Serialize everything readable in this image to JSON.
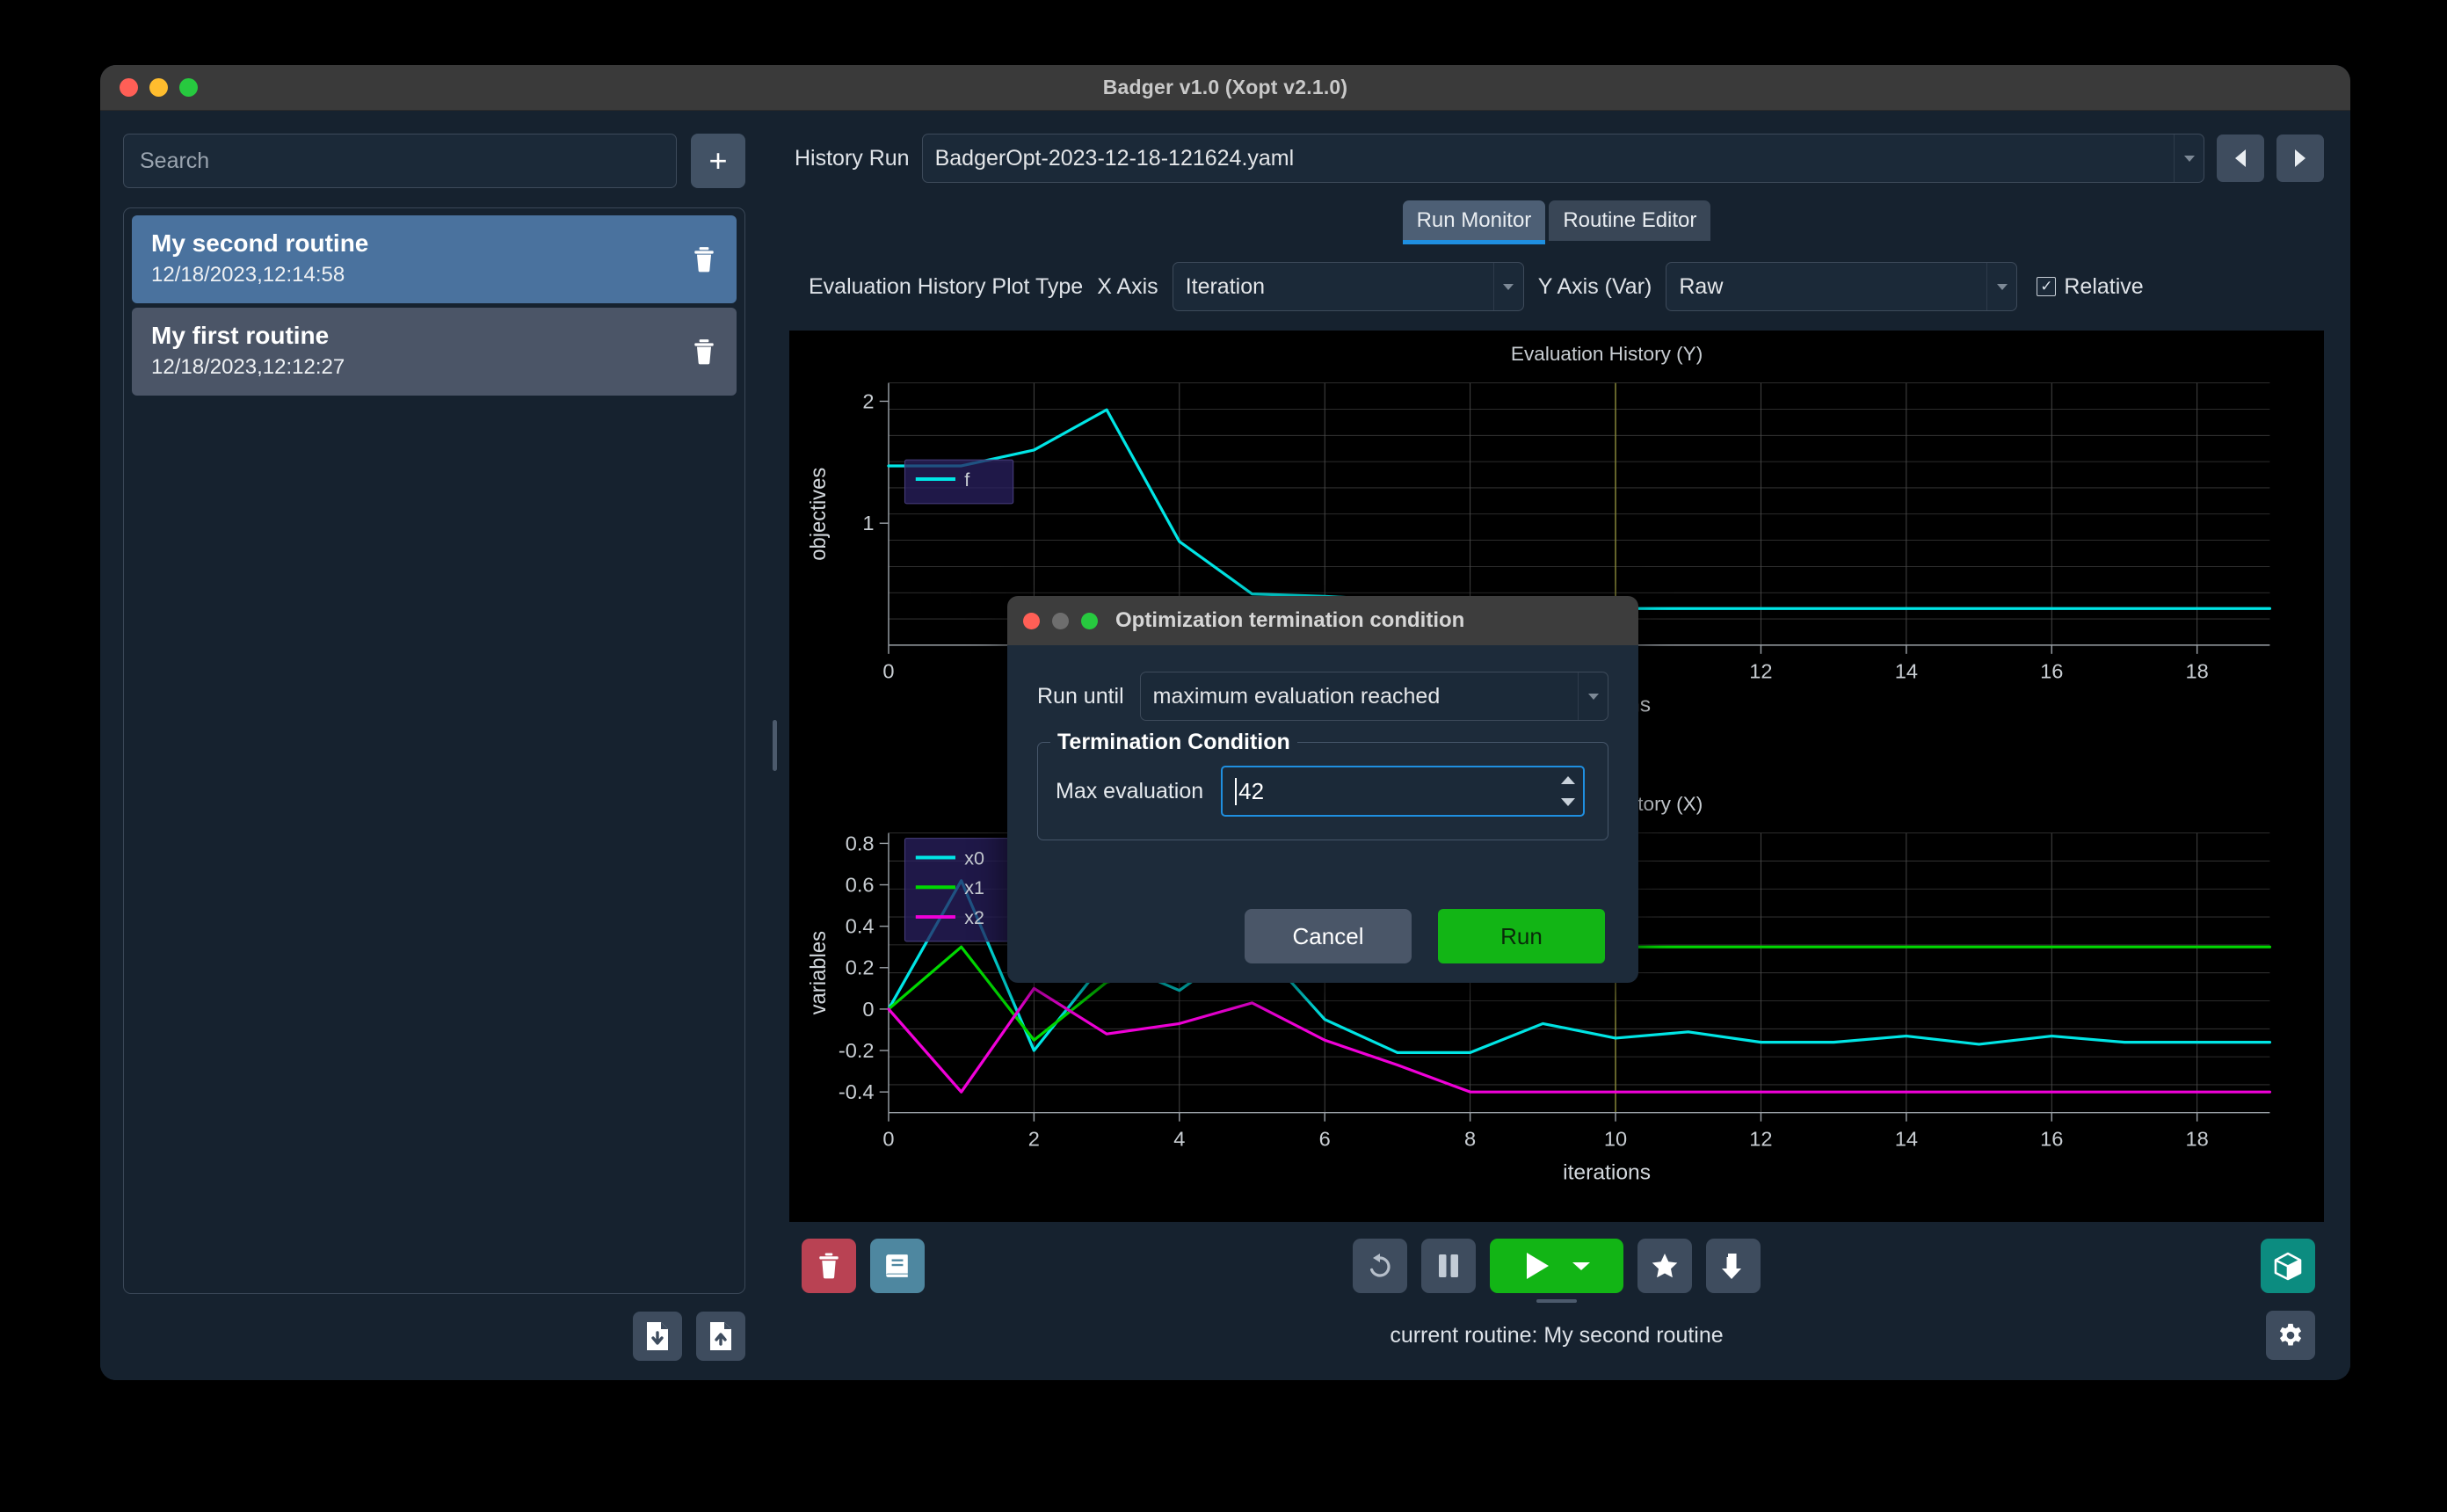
{
  "window": {
    "title": "Badger v1.0 (Xopt v2.1.0)",
    "traffic_lights": [
      "close",
      "minimize",
      "maximize"
    ]
  },
  "sidebar": {
    "search": {
      "placeholder": "Search",
      "value": ""
    },
    "add_button_label": "+",
    "routines": [
      {
        "name": "My second routine",
        "timestamp": "12/18/2023,12:14:58",
        "selected": true
      },
      {
        "name": "My first routine",
        "timestamp": "12/18/2023,12:12:27",
        "selected": false
      }
    ],
    "footer": {
      "import_icon": "file-download-icon",
      "export_icon": "file-upload-icon"
    }
  },
  "main": {
    "history": {
      "label": "History Run",
      "value": "BadgerOpt-2023-12-18-121624.yaml",
      "prev_icon": "chevron-left-icon",
      "next_icon": "chevron-right-icon"
    },
    "tabs": [
      {
        "label": "Run Monitor",
        "active": true
      },
      {
        "label": "Routine Editor",
        "active": false
      }
    ],
    "controls": {
      "plot_type_label": "Evaluation History Plot Type",
      "x_axis_label": "X Axis",
      "x_axis_value": "Iteration",
      "y_axis_label": "Y Axis (Var)",
      "y_axis_value": "Raw",
      "relative_label": "Relative",
      "relative_checked": true,
      "check_glyph": "✓"
    },
    "toolbar": {
      "delete_icon": "trash-icon",
      "log_icon": "book-icon",
      "reset_icon": "undo-icon",
      "pause_icon": "pause-icon",
      "run_icon": "play-icon",
      "run_menu_icon": "chevron-down-icon",
      "favorite_icon": "star-icon",
      "dial_in_icon": "arrow-down-corner-icon",
      "extension_icon": "cube-icon"
    },
    "status": {
      "text": "current routine: My second routine",
      "settings_icon": "gear-icon"
    }
  },
  "dialog": {
    "title": "Optimization termination condition",
    "run_until_label": "Run until",
    "run_until_value": "maximum evaluation reached",
    "group_title": "Termination Condition",
    "max_eval_label": "Max evaluation",
    "max_eval_value": "42",
    "cancel_label": "Cancel",
    "run_label": "Run"
  },
  "colors": {
    "accent_blue": "#1f8fe0",
    "run_green": "#12b515",
    "delete_red": "#b94253",
    "log_blue": "#4e87a0",
    "extension_teal": "#0c8c80",
    "selected_routine": "#4a729e",
    "series_x0": "#00e5e5",
    "series_x1": "#00d800",
    "series_x2": "#f000d8",
    "series_f": "#00e5e5"
  },
  "chart_data": [
    {
      "type": "line",
      "title": "Evaluation History (Y)",
      "xlabel": "iterations",
      "ylabel": "objectives",
      "xlim": [
        0,
        19
      ],
      "ylim": [
        0,
        2.15
      ],
      "xticks": [
        0,
        2,
        4,
        6,
        8,
        10,
        12,
        14,
        16,
        18
      ],
      "yticks": [
        1,
        2
      ],
      "grid": true,
      "legend": [
        "f"
      ],
      "legend_position": "upper-left",
      "x": [
        0,
        1,
        2,
        3,
        4,
        5,
        6,
        7,
        8,
        9,
        10,
        11,
        12,
        13,
        14,
        15,
        16,
        17,
        18,
        19
      ],
      "series": [
        {
          "name": "f",
          "color": "#00e5e5",
          "values": [
            1.47,
            1.47,
            1.6,
            1.93,
            0.85,
            0.42,
            0.4,
            0.37,
            0.33,
            0.31,
            0.3,
            0.3,
            0.3,
            0.3,
            0.3,
            0.3,
            0.3,
            0.3,
            0.3,
            0.3
          ]
        }
      ]
    },
    {
      "type": "line",
      "title": "Evaluation History (X)",
      "xlabel": "iterations",
      "ylabel": "variables",
      "xlim": [
        0,
        19
      ],
      "ylim": [
        -0.5,
        0.85
      ],
      "xticks": [
        0,
        2,
        4,
        6,
        8,
        10,
        12,
        14,
        16,
        18
      ],
      "yticks": [
        -0.4,
        -0.2,
        0,
        0.2,
        0.4,
        0.6,
        0.8
      ],
      "grid": true,
      "legend": [
        "x0",
        "x1",
        "x2"
      ],
      "legend_position": "upper-left",
      "x": [
        0,
        1,
        2,
        3,
        4,
        5,
        6,
        7,
        8,
        9,
        10,
        11,
        12,
        13,
        14,
        15,
        16,
        17,
        18,
        19
      ],
      "series": [
        {
          "name": "x0",
          "color": "#00e5e5",
          "values": [
            0.0,
            0.62,
            -0.2,
            0.24,
            0.09,
            0.34,
            -0.05,
            -0.21,
            -0.21,
            -0.07,
            -0.14,
            -0.11,
            -0.16,
            -0.16,
            -0.13,
            -0.17,
            -0.13,
            -0.16,
            -0.16,
            -0.16
          ]
        },
        {
          "name": "x1",
          "color": "#00d800",
          "values": [
            0.0,
            0.3,
            -0.15,
            0.13,
            0.21,
            0.3,
            0.28,
            0.3,
            0.25,
            0.28,
            0.3,
            0.3,
            0.3,
            0.3,
            0.3,
            0.3,
            0.3,
            0.3,
            0.3,
            0.3
          ]
        },
        {
          "name": "x2",
          "color": "#f000d8",
          "values": [
            0.0,
            -0.4,
            0.1,
            -0.12,
            -0.07,
            0.03,
            -0.15,
            -0.27,
            -0.4,
            -0.4,
            -0.4,
            -0.4,
            -0.4,
            -0.4,
            -0.4,
            -0.4,
            -0.4,
            -0.4,
            -0.4,
            -0.4
          ]
        }
      ]
    }
  ]
}
